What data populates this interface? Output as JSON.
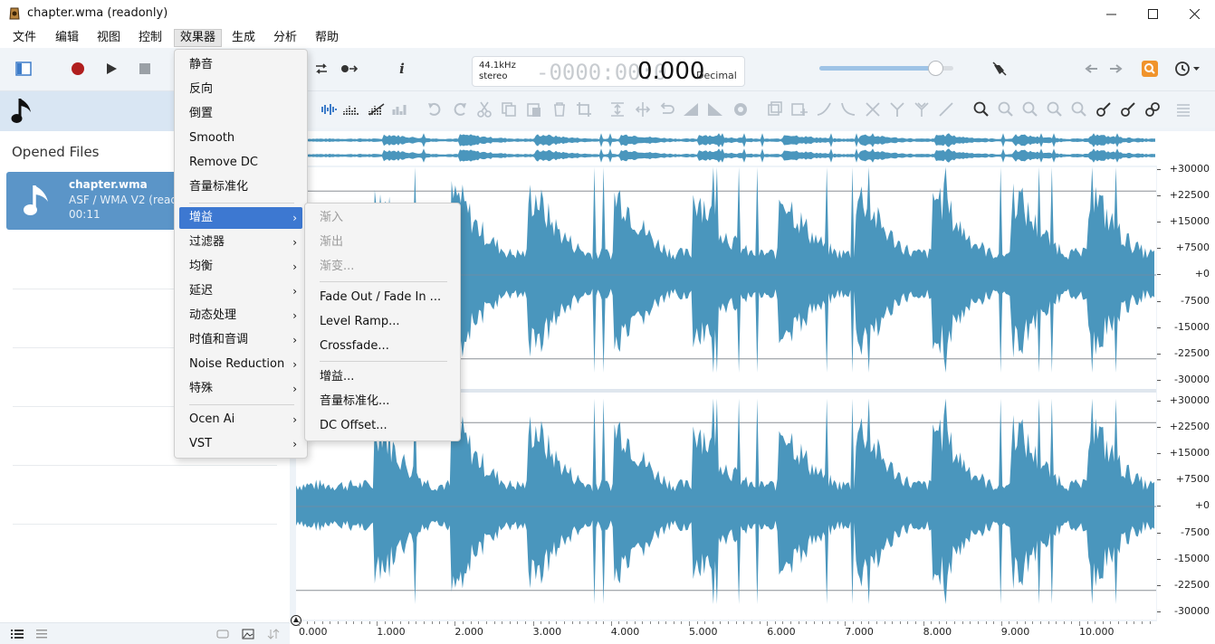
{
  "window": {
    "title": "chapter.wma (readonly)",
    "controls": [
      "minimize",
      "maximize",
      "close"
    ]
  },
  "menubar": [
    {
      "label": "文件"
    },
    {
      "label": "编辑"
    },
    {
      "label": "视图"
    },
    {
      "label": "控制"
    },
    {
      "label": "效果器",
      "active": true
    },
    {
      "label": "生成"
    },
    {
      "label": "分析"
    },
    {
      "label": "帮助"
    }
  ],
  "display": {
    "sample_rate": "44.1kHz",
    "channels": "stereo",
    "time_dim": "-0000:00:0",
    "time_value": "0.000",
    "format": "Decimal"
  },
  "volume": {
    "level": 0.87
  },
  "left_panel": {
    "section_title": "Opened Files",
    "files": [
      {
        "name": "chapter.wma",
        "info": "ASF / WMA V2 (readonly)",
        "duration": "00:11"
      }
    ]
  },
  "effects_menu": {
    "items": [
      {
        "label": "静音"
      },
      {
        "label": "反向"
      },
      {
        "label": "倒置"
      },
      {
        "label": "Smooth"
      },
      {
        "label": "Remove DC"
      },
      {
        "label": "音量标准化"
      },
      {
        "label": "增益",
        "submenu": true,
        "highlighted": true
      },
      {
        "label": "过滤器",
        "submenu": true
      },
      {
        "label": "均衡",
        "submenu": true
      },
      {
        "label": "延迟",
        "submenu": true
      },
      {
        "label": "动态处理",
        "submenu": true
      },
      {
        "label": "时值和音调",
        "submenu": true
      },
      {
        "label": "Noise Reduction",
        "submenu": true
      },
      {
        "label": "特殊",
        "submenu": true
      },
      {
        "label": "Ocen Ai",
        "submenu": true
      },
      {
        "label": "VST",
        "submenu": true
      }
    ]
  },
  "gain_submenu": {
    "items": [
      {
        "label": "渐入",
        "disabled": true
      },
      {
        "label": "渐出",
        "disabled": true
      },
      {
        "label": "渐变...",
        "disabled": true
      },
      {
        "label": "Fade Out / Fade In ..."
      },
      {
        "label": "Level Ramp..."
      },
      {
        "label": "Crossfade..."
      },
      {
        "label": "增益..."
      },
      {
        "label": "音量标准化..."
      },
      {
        "label": "DC Offset..."
      }
    ]
  },
  "amplitude_scale": {
    "channel1": [
      "+30000",
      "+22500",
      "+15000",
      "+7500",
      "+0",
      "-7500",
      "-15000",
      "-22500",
      "-30000"
    ],
    "channel2": [
      "+30000",
      "+22500",
      "+15000",
      "+7500",
      "+0",
      "-7500",
      "-15000",
      "-22500",
      "-30000"
    ]
  },
  "time_ruler": [
    "0.000",
    "1.000",
    "2.000",
    "3.000",
    "4.000",
    "5.000",
    "6.000",
    "7.000",
    "8.000",
    "9.000",
    "10.000"
  ],
  "colors": {
    "waveform": "#4a96bd",
    "accent": "#3d78d1",
    "file_card": "#5b95c8",
    "record": "#b01e1e"
  }
}
